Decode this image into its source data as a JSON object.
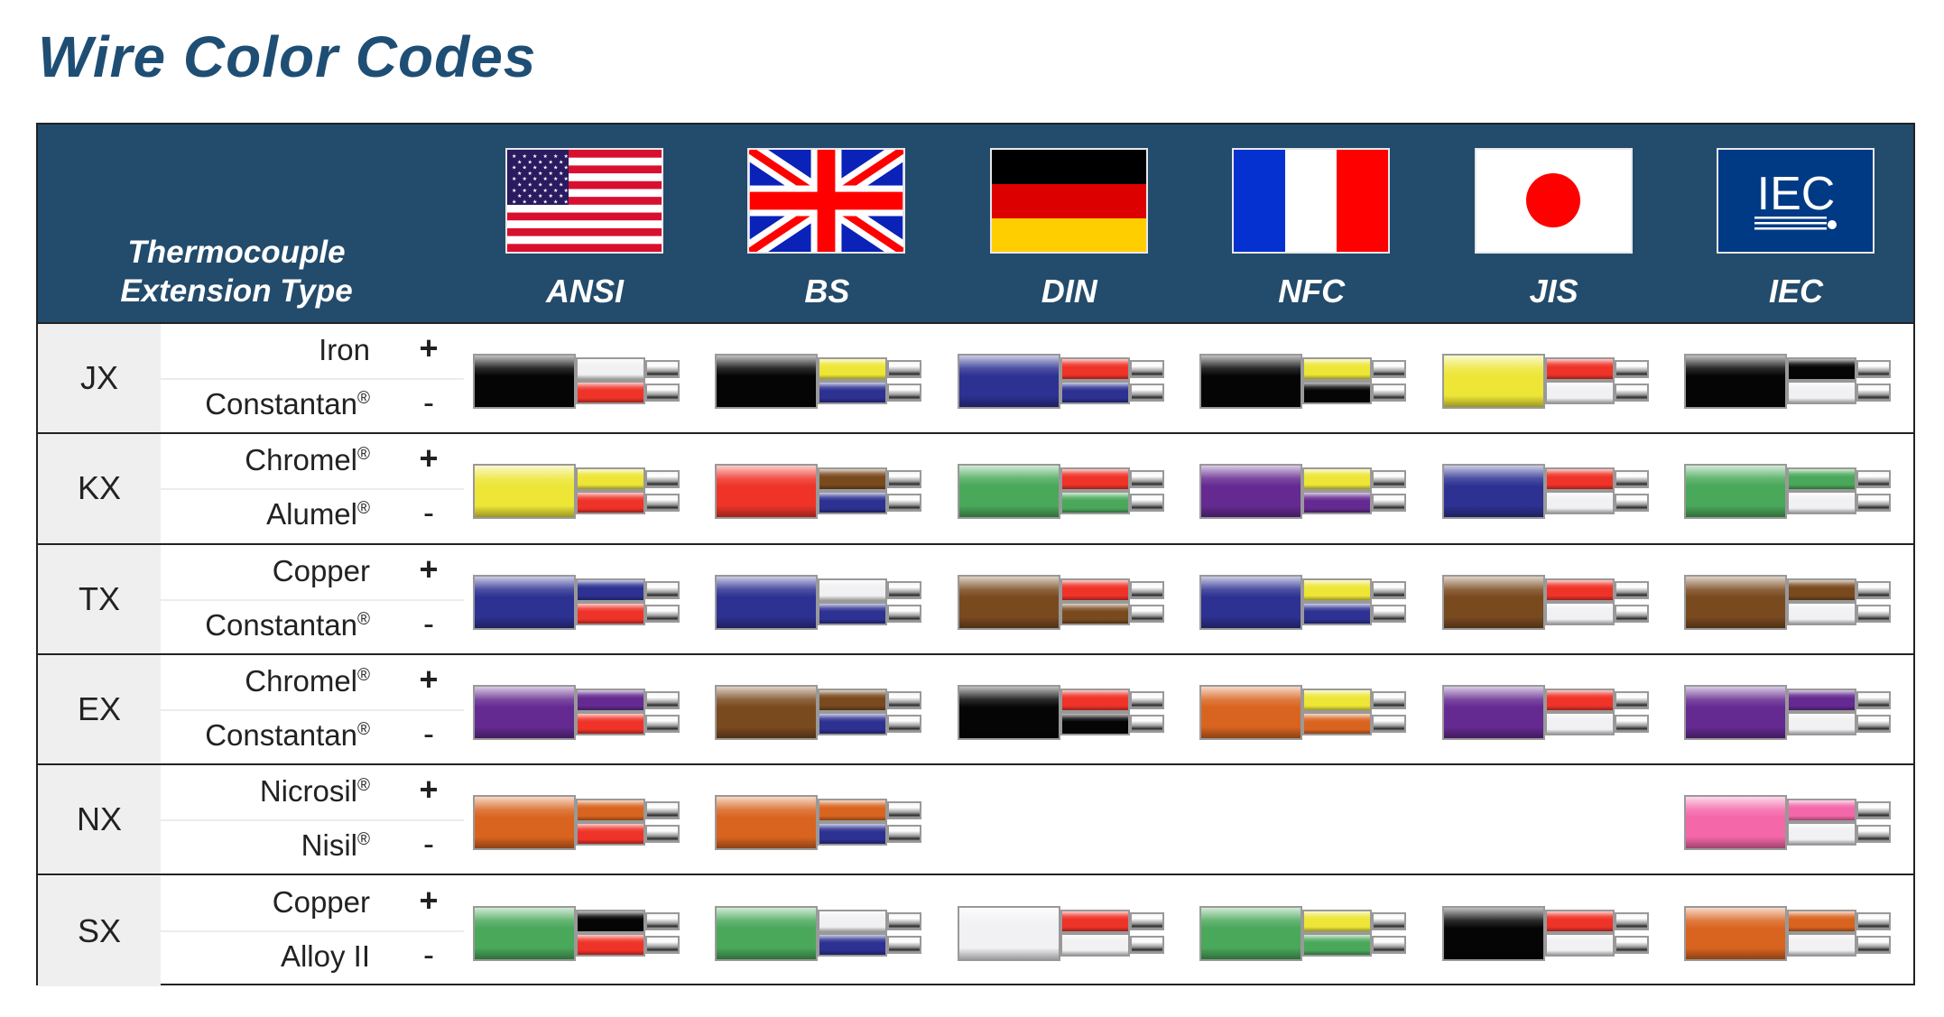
{
  "title": "Wire Color Codes",
  "header": {
    "type_label_line1": "Thermocouple",
    "type_label_line2": "Extension Type"
  },
  "colors": {
    "title": "#1f4e74",
    "header_bg": "#234b6b",
    "black": "#050505",
    "white": "#f1f1f3",
    "red": "#ef3328",
    "blue": "#2d3192",
    "yellow": "#ede637",
    "brown": "#7a4a1f",
    "green": "#4aa85a",
    "purple": "#652a91",
    "orange": "#d9641f",
    "pink": "#f467a9"
  },
  "standards": [
    {
      "code": "ANSI",
      "icon": "us-flag-icon"
    },
    {
      "code": "BS",
      "icon": "uk-flag-icon"
    },
    {
      "code": "DIN",
      "icon": "germany-flag-icon"
    },
    {
      "code": "NFC",
      "icon": "france-flag-icon"
    },
    {
      "code": "JIS",
      "icon": "japan-flag-icon"
    },
    {
      "code": "IEC",
      "icon": "iec-logo-icon",
      "logo_text": "IEC"
    }
  ],
  "rows": [
    {
      "type": "JX",
      "positive": {
        "name": "Iron",
        "reg": "",
        "sign": "+"
      },
      "negative": {
        "name": "Constantan",
        "reg": "®",
        "sign": "-"
      },
      "wires": [
        [
          "black",
          "white",
          "red"
        ],
        [
          "black",
          "yellow",
          "blue"
        ],
        [
          "blue",
          "red",
          "blue"
        ],
        [
          "black",
          "yellow",
          "black"
        ],
        [
          "yellow",
          "red",
          "white"
        ],
        [
          "black",
          "black",
          "white"
        ]
      ]
    },
    {
      "type": "KX",
      "positive": {
        "name": "Chromel",
        "reg": "®",
        "sign": "+"
      },
      "negative": {
        "name": "Alumel",
        "reg": "®",
        "sign": "-"
      },
      "wires": [
        [
          "yellow",
          "yellow",
          "red"
        ],
        [
          "red",
          "brown",
          "blue"
        ],
        [
          "green",
          "red",
          "green"
        ],
        [
          "purple",
          "yellow",
          "purple"
        ],
        [
          "blue",
          "red",
          "white"
        ],
        [
          "green",
          "green",
          "white"
        ]
      ]
    },
    {
      "type": "TX",
      "positive": {
        "name": "Copper",
        "reg": "",
        "sign": "+"
      },
      "negative": {
        "name": "Constantan",
        "reg": "®",
        "sign": "-"
      },
      "wires": [
        [
          "blue",
          "blue",
          "red"
        ],
        [
          "blue",
          "white",
          "blue"
        ],
        [
          "brown",
          "red",
          "brown"
        ],
        [
          "blue",
          "yellow",
          "blue"
        ],
        [
          "brown",
          "red",
          "white"
        ],
        [
          "brown",
          "brown",
          "white"
        ]
      ]
    },
    {
      "type": "EX",
      "positive": {
        "name": "Chromel",
        "reg": "®",
        "sign": "+"
      },
      "negative": {
        "name": "Constantan",
        "reg": "®",
        "sign": "-"
      },
      "wires": [
        [
          "purple",
          "purple",
          "red"
        ],
        [
          "brown",
          "brown",
          "blue"
        ],
        [
          "black",
          "red",
          "black"
        ],
        [
          "orange",
          "yellow",
          "orange"
        ],
        [
          "purple",
          "red",
          "white"
        ],
        [
          "purple",
          "purple",
          "white"
        ]
      ]
    },
    {
      "type": "NX",
      "positive": {
        "name": "Nicrosil",
        "reg": "®",
        "sign": "+"
      },
      "negative": {
        "name": "Nisil",
        "reg": "®",
        "sign": "-"
      },
      "wires": [
        [
          "orange",
          "orange",
          "red"
        ],
        [
          "orange",
          "orange",
          "blue"
        ],
        null,
        null,
        null,
        [
          "pink",
          "pink",
          "white"
        ]
      ]
    },
    {
      "type": "SX",
      "positive": {
        "name": "Copper",
        "reg": "",
        "sign": "+"
      },
      "negative": {
        "name": "Alloy II",
        "reg": "",
        "sign": "-"
      },
      "wires": [
        [
          "green",
          "black",
          "red"
        ],
        [
          "green",
          "white",
          "blue"
        ],
        [
          "white",
          "red",
          "white"
        ],
        [
          "green",
          "yellow",
          "green"
        ],
        [
          "black",
          "red",
          "white"
        ],
        [
          "orange",
          "orange",
          "white"
        ]
      ]
    }
  ]
}
